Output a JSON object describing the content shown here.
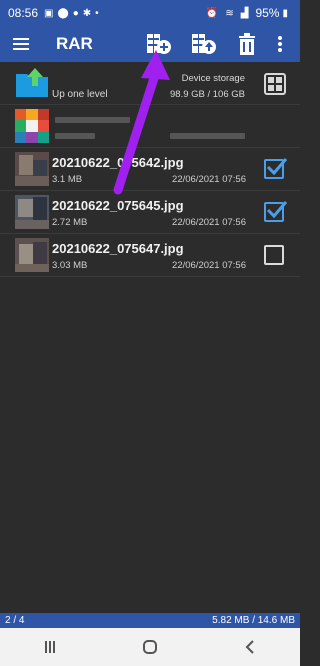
{
  "status_bar": {
    "time": "08:56",
    "battery": "95%",
    "icons": [
      "image-icon",
      "pin-icon",
      "bulb-icon",
      "gear-icon",
      "dot-icon"
    ],
    "right_icons": [
      "alarm-icon",
      "wifi-icon",
      "signal-icon",
      "battery-icon"
    ]
  },
  "toolbar": {
    "title": "RAR",
    "buttons": [
      "add-to-archive-icon",
      "extract-icon",
      "delete-icon",
      "more-options-icon"
    ]
  },
  "up_row": {
    "label": "Up one level",
    "storage_label": "Device storage",
    "storage_size": "98.9 GB / 106 GB"
  },
  "files": [
    {
      "name": "20210622_075642.jpg",
      "size": "3.1 MB",
      "date": "22/06/2021 07:56",
      "checked": true
    },
    {
      "name": "20210622_075645.jpg",
      "size": "2.72 MB",
      "date": "22/06/2021 07:56",
      "checked": true
    },
    {
      "name": "20210622_075647.jpg",
      "size": "3.03 MB",
      "date": "22/06/2021 07:56",
      "checked": false
    }
  ],
  "bottom_bar": {
    "selection_count": "2 / 4",
    "selection_size": "5.82 MB / 14.6 MB"
  },
  "nav": [
    "recent-apps-icon",
    "home-icon",
    "back-icon"
  ],
  "colors": {
    "primary": "#2f55a6",
    "background": "#2c2c2c",
    "checkbox_checked": "#4b9ee8",
    "annotation_arrow": "#a020f0"
  }
}
